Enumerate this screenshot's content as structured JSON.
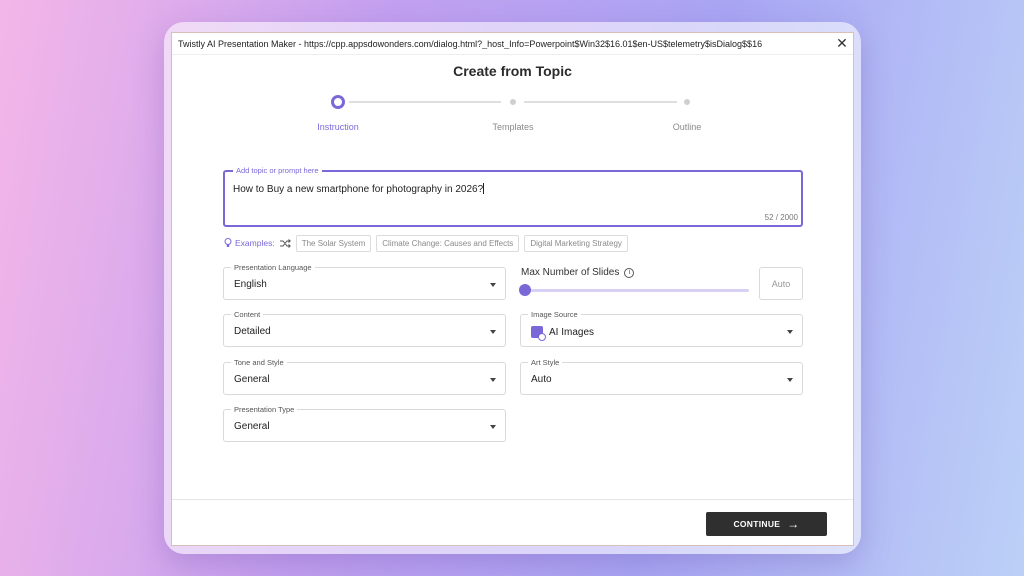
{
  "window": {
    "title": "Twistly AI Presentation Maker - https://cpp.appsdowonders.com/dialog.html?_host_Info=Powerpoint$Win32$16.01$en-US$telemetry$isDialog$$16",
    "close_glyph": "✕"
  },
  "page": {
    "heading": "Create from Topic"
  },
  "stepper": {
    "steps": [
      {
        "label": "Instruction",
        "active": true
      },
      {
        "label": "Templates",
        "active": false
      },
      {
        "label": "Outline",
        "active": false
      }
    ]
  },
  "topic": {
    "legend": "Add topic or prompt here",
    "value": "How to Buy a new smartphone for photography in 2026?",
    "count": "52 / 2000"
  },
  "examples": {
    "label": "Examples:",
    "chips": [
      "The Solar System",
      "Climate Change: Causes and Effects",
      "Digital Marketing Strategy"
    ]
  },
  "fields": {
    "language": {
      "legend": "Presentation Language",
      "value": "English"
    },
    "content": {
      "legend": "Content",
      "value": "Detailed"
    },
    "tone": {
      "legend": "Tone and Style",
      "value": "General"
    },
    "type": {
      "legend": "Presentation Type",
      "value": "General"
    },
    "image_source": {
      "legend": "Image Source",
      "value": "AI Images",
      "icon": "ai-image-icon"
    },
    "art_style": {
      "legend": "Art Style",
      "value": "Auto"
    }
  },
  "slides": {
    "label": "Max Number of Slides",
    "value_text": "Auto",
    "slider_value": 0
  },
  "footer": {
    "continue_label": "CONTINUE"
  },
  "colors": {
    "accent": "#7b68d8",
    "button": "#2f2f2f"
  }
}
